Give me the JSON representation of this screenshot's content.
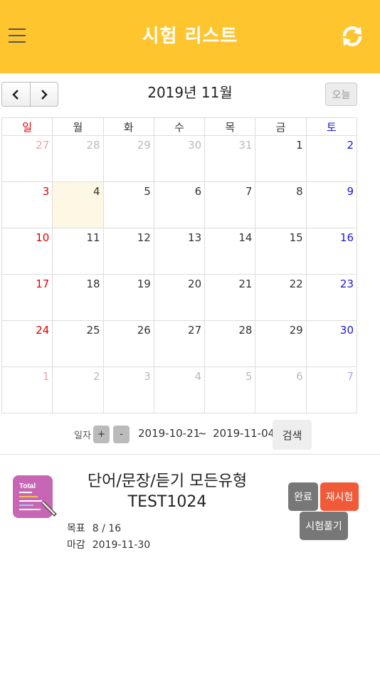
{
  "header": {
    "title": "시험 리스트",
    "menu_icon": "hamburger-menu-icon",
    "refresh_icon": "refresh-icon"
  },
  "calendar": {
    "month_title": "2019년 11월",
    "today_label": "오늘",
    "weekdays": [
      "일",
      "월",
      "화",
      "수",
      "목",
      "금",
      "토"
    ],
    "weeks": [
      [
        "27",
        "28",
        "29",
        "30",
        "31",
        "1",
        "2"
      ],
      [
        "3",
        "4",
        "5",
        "6",
        "7",
        "8",
        "9"
      ],
      [
        "10",
        "11",
        "12",
        "13",
        "14",
        "15",
        "16"
      ],
      [
        "17",
        "18",
        "19",
        "20",
        "21",
        "22",
        "23"
      ],
      [
        "24",
        "25",
        "26",
        "27",
        "28",
        "29",
        "30"
      ],
      [
        "1",
        "2",
        "3",
        "4",
        "5",
        "6",
        "7"
      ]
    ],
    "today_highlight_color": "#FCF8E3"
  },
  "search": {
    "date_label": "일자",
    "plus_label": "+",
    "minus_label": "-",
    "date_from": "2019-10-21",
    "tilde": "~",
    "date_to": "2019-11-04",
    "search_label": "검색"
  },
  "exam": {
    "icon_text": "Total",
    "title_line1": "단어/문장/듣기 모든유형",
    "title_line2": "TEST1024",
    "goal_label": "목표",
    "goal_value": "8 / 16",
    "deadline_label": "마감",
    "deadline_value": "2019-11-30",
    "done_label": "완료",
    "retest_label": "재시험",
    "solve_label": "시험풀기"
  },
  "colors": {
    "header": "#FFC52F",
    "retest": "#F05A38",
    "sunday": "#e30000",
    "saturday": "#1a1ad6"
  }
}
